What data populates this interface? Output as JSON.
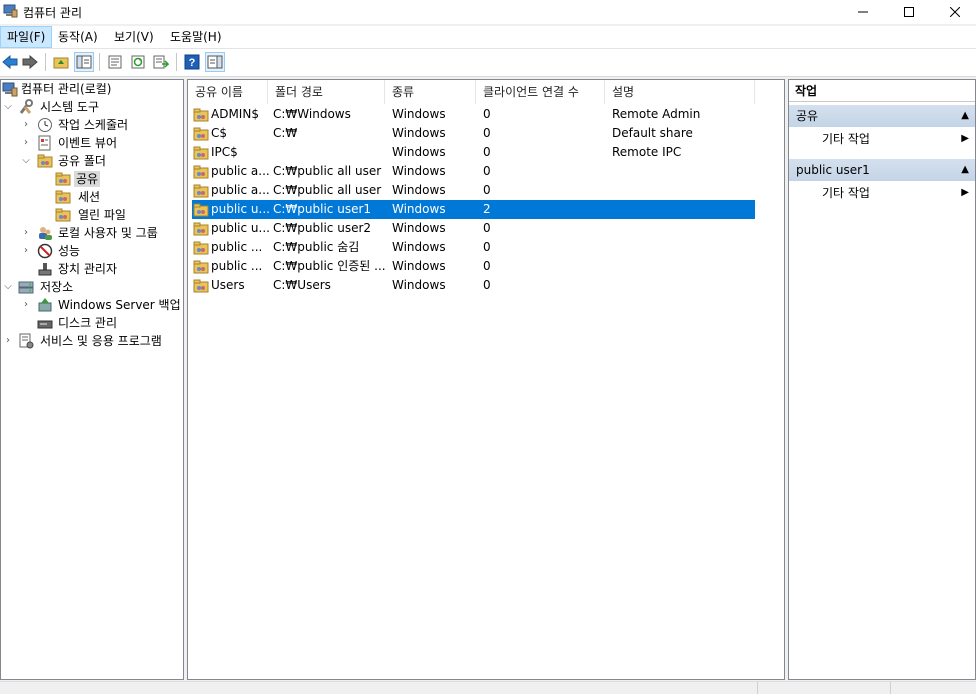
{
  "window": {
    "title": "컴퓨터 관리"
  },
  "menu": [
    {
      "label": "파일(F)"
    },
    {
      "label": "동작(A)"
    },
    {
      "label": "보기(V)"
    },
    {
      "label": "도움말(H)"
    }
  ],
  "toolbar": {
    "buttons": [
      "back-icon",
      "forward-icon",
      "up-folder-icon",
      "show-hide-tree-icon",
      "properties-icon",
      "refresh-icon",
      "export-list-icon",
      "help-icon",
      "show-hide-action-pane-icon"
    ]
  },
  "tree": [
    {
      "label": "컴퓨터 관리(로컬)"
    },
    {
      "label": "시스템 도구"
    },
    {
      "label": "작업 스케줄러"
    },
    {
      "label": "이벤트 뷰어"
    },
    {
      "label": "공유 폴더"
    },
    {
      "label": "공유"
    },
    {
      "label": "세션"
    },
    {
      "label": "열린 파일"
    },
    {
      "label": "로컬 사용자 및 그룹"
    },
    {
      "label": "성능"
    },
    {
      "label": "장치 관리자"
    },
    {
      "label": "저장소"
    },
    {
      "label": "Windows Server 백업"
    },
    {
      "label": "디스크 관리"
    },
    {
      "label": "서비스 및 응용 프로그램"
    }
  ],
  "list": {
    "columns": [
      "공유 이름",
      "폴더 경로",
      "종류",
      "클라이언트 연결 수",
      "설명"
    ],
    "rows": [
      {
        "name": "ADMIN$",
        "path": "C:₩Windows",
        "type": "Windows",
        "clients": "0",
        "desc": "Remote Admin"
      },
      {
        "name": "C$",
        "path": "C:₩",
        "type": "Windows",
        "clients": "0",
        "desc": "Default share"
      },
      {
        "name": "IPC$",
        "path": "",
        "type": "Windows",
        "clients": "0",
        "desc": "Remote IPC"
      },
      {
        "name": "public a...",
        "path": "C:₩public all user r",
        "type": "Windows",
        "clients": "0",
        "desc": ""
      },
      {
        "name": "public a...",
        "path": "C:₩public all user ...",
        "type": "Windows",
        "clients": "0",
        "desc": ""
      },
      {
        "name": "public u...",
        "path": "C:₩public user1",
        "type": "Windows",
        "clients": "2",
        "desc": ""
      },
      {
        "name": "public u...",
        "path": "C:₩public user2",
        "type": "Windows",
        "clients": "0",
        "desc": ""
      },
      {
        "name": "public ...",
        "path": "C:₩public 숨김",
        "type": "Windows",
        "clients": "0",
        "desc": ""
      },
      {
        "name": "public ...",
        "path": "C:₩public 인증된 ...",
        "type": "Windows",
        "clients": "0",
        "desc": ""
      },
      {
        "name": "Users",
        "path": "C:₩Users",
        "type": "Windows",
        "clients": "0",
        "desc": ""
      }
    ]
  },
  "actions": {
    "title": "작업",
    "sections": [
      {
        "header": "공유",
        "item": "기타 작업"
      },
      {
        "header": "public user1",
        "item": "기타 작업"
      }
    ]
  },
  "colors": {
    "selection": "#0078d7",
    "action_header": "#c8d7e8",
    "menu_active": "#cce8ff"
  }
}
